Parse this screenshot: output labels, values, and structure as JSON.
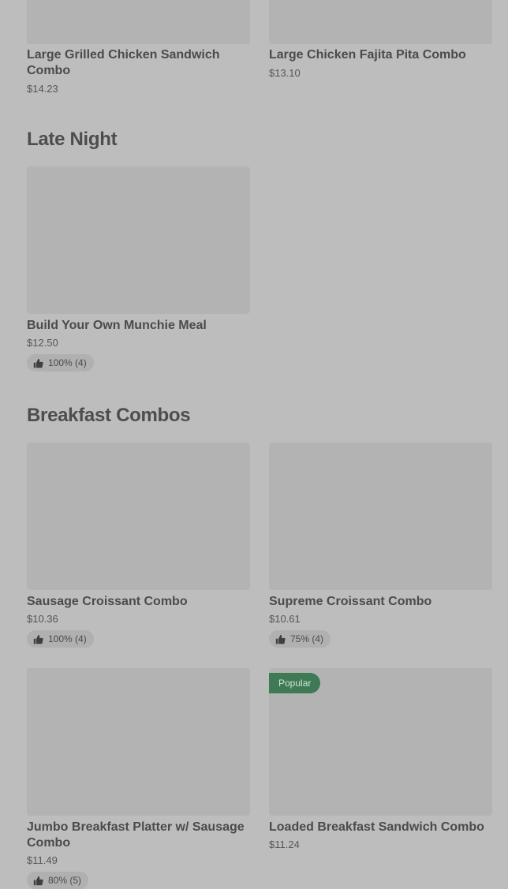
{
  "sections": {
    "prev": {
      "items": [
        {
          "name": "Large Grilled Chicken Sandwich Combo",
          "price": "$14.23"
        },
        {
          "name": "Large Chicken Fajita Pita Combo",
          "price": "$13.10"
        }
      ]
    },
    "late_night": {
      "title": "Late Night",
      "items": [
        {
          "name": "Build Your Own Munchie Meal",
          "price": "$12.50",
          "rating": "100% (4)"
        }
      ]
    },
    "breakfast": {
      "title": "Breakfast Combos",
      "items": [
        {
          "name": "Sausage Croissant Combo",
          "price": "$10.36",
          "rating": "100% (4)"
        },
        {
          "name": "Supreme Croissant Combo",
          "price": "$10.61",
          "rating": "75% (4)"
        },
        {
          "name": "Jumbo Breakfast Platter w/ Sausage Combo",
          "price": "$11.49",
          "rating": "80% (5)"
        },
        {
          "name": "Loaded Breakfast Sandwich Combo",
          "price": "$11.24",
          "badge": "Popular"
        }
      ]
    }
  },
  "colors": {
    "badge_bg": "#3e7a54",
    "overlay": "#bdbdbd"
  },
  "icons": {
    "rating": "thumbs-up-icon"
  }
}
